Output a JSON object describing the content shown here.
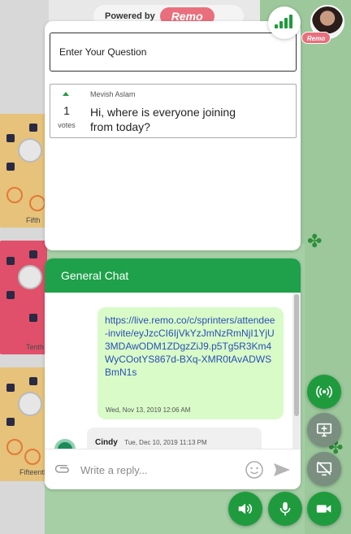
{
  "app": {
    "powered_by": "Powered by",
    "brand": "Remo",
    "avatar_badge": "Remo"
  },
  "background": {
    "rooms": [
      "Fifth",
      "Tenth",
      "Fifteenth"
    ]
  },
  "qa": {
    "input_placeholder": "Enter Your Question",
    "questions": [
      {
        "asker": "Mevish Aslam",
        "votes": "1",
        "votes_label": "votes",
        "text": "Hi, where is everyone joining from today?"
      }
    ]
  },
  "chat": {
    "title": "General Chat",
    "messages": [
      {
        "direction": "outgoing",
        "text": "https://live.remo.co/c/sprinters/attendee-invite/eyJzcCI6IjVkYzJmNzRmNjI1YjU3MDAwODM1ZDgzZiJ9.p5Tg5R3Km4WyCOotYS867d-BXq-XMR0tAvADWSBmN1s",
        "time": "Wed, Nov 13, 2019 12:06 AM"
      },
      {
        "direction": "incoming",
        "sender": "Cindy",
        "time": "Tue, Dec 10, 2019 11:13 PM"
      }
    ],
    "reply_placeholder": "Write a reply..."
  },
  "icons": {
    "signal": "signal-strength-icon",
    "broadcast": "broadcast-icon",
    "screen_share": "screen-share-icon",
    "stop_screen_share": "screen-share-off-icon",
    "speaker": "speaker-icon",
    "mic": "microphone-icon",
    "camera": "camera-icon",
    "attach": "paperclip-icon",
    "emoji": "emoji-icon",
    "send": "send-icon"
  },
  "colors": {
    "accent_green": "#1f9b3e",
    "remo_pink": "#e96f7d",
    "bubble_green": "#d8fbc8",
    "link_blue": "#2a4fb3"
  }
}
